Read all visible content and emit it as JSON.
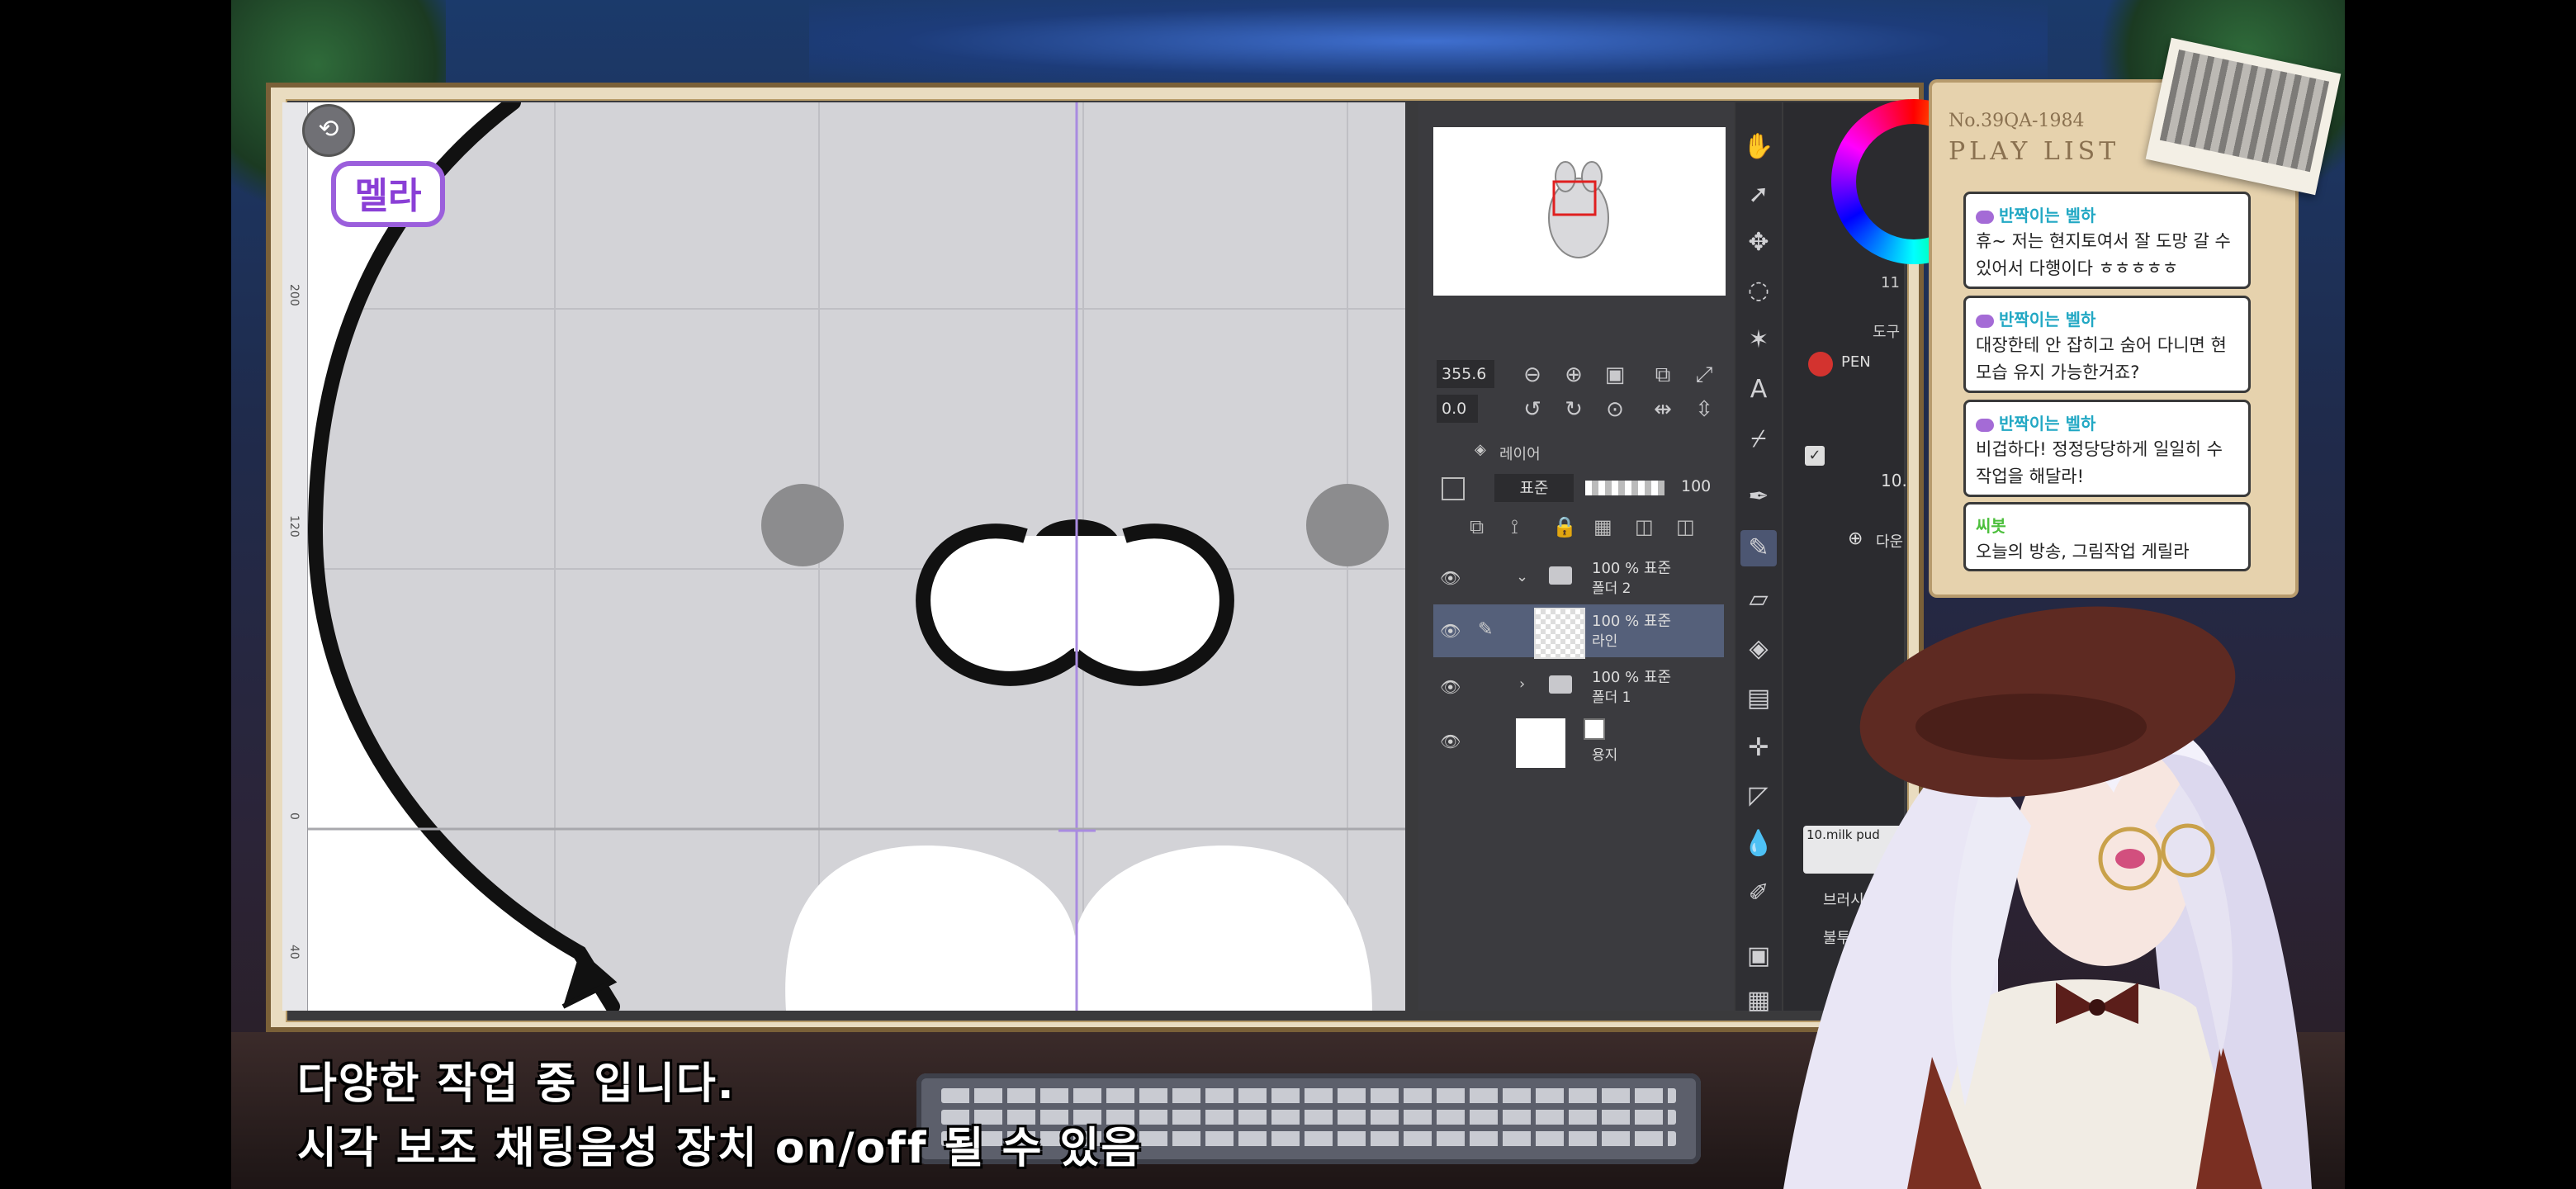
{
  "logo_text": "멜라",
  "app": {
    "navigator": {
      "zoom_value": "355.6",
      "angle_value": "0.0"
    },
    "layers": {
      "tab_label": "레이어",
      "blend_mode": "표준",
      "opacity": "100",
      "items": [
        {
          "pct": "100 % 표준",
          "name": "폴더 2",
          "type": "folder"
        },
        {
          "pct": "100 % 표준",
          "name": "라인",
          "type": "raster",
          "active": true
        },
        {
          "pct": "100 % 표준",
          "name": "폴더 1",
          "type": "folder"
        },
        {
          "pct": "",
          "name": "용지",
          "type": "paper"
        }
      ]
    },
    "subtool": {
      "tab_label": "도구",
      "pen_label": "PEN",
      "size_value": "10.",
      "size_small": "11",
      "add_label": "다운",
      "brush_name": "10.milk pud",
      "brush_size_label": "브러시 크기",
      "opacity_label": "불투명도"
    }
  },
  "playlist": {
    "number": "No.39QA-1984",
    "title": "PLAY LIST"
  },
  "chat": [
    {
      "user": "반짝이는 벨하",
      "text": "휴~ 저는 현지토여서 잘 도망 갈 수 있어서 다행이다 ㅎㅎㅎㅎㅎ",
      "user_color": "blue"
    },
    {
      "user": "반짝이는 벨하",
      "text": "대장한테 안 잡히고 숨어 다니면 현모습 유지 가능한거죠?",
      "user_color": "blue"
    },
    {
      "user": "반짝이는 벨하",
      "text": "비겁하다! 정정당당하게 일일히 수작업을 해달라!",
      "user_color": "blue"
    },
    {
      "user": "씨봇",
      "text": "오늘의 방송, 그림작업 게릴라",
      "user_color": "green"
    }
  ],
  "subtitles": {
    "line1": "다양한 작업 중 입니다.",
    "line2": "시각 보조 채팅음성 장치 on/off 될 수 있음"
  },
  "colors": {
    "canvas_bg": "#d3d3d7",
    "panel_bg": "#3b3b3f",
    "active_layer": "#55607a",
    "guide_line": "#a98be0",
    "chat_user": "#22a8c4",
    "bot_user": "#4cbf3c"
  }
}
